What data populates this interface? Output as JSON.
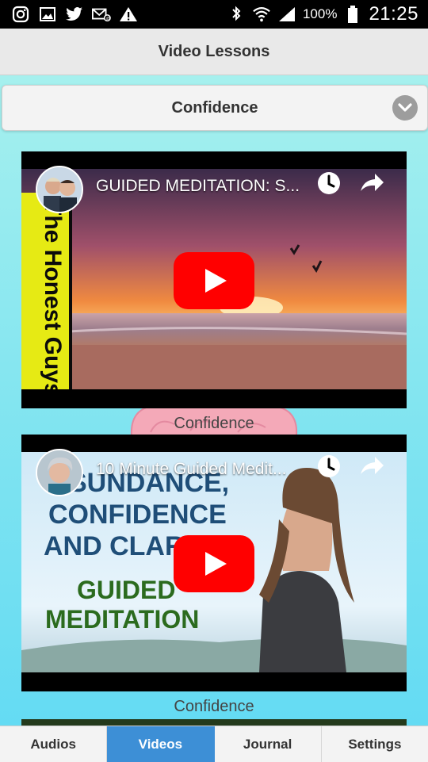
{
  "status_bar": {
    "battery": "100%",
    "time": "21:25",
    "left_icons": [
      "instagram-icon",
      "image-icon",
      "twitter-icon",
      "mail-icon",
      "warning-icon"
    ],
    "right_icons": [
      "bluetooth-icon",
      "wifi-icon",
      "signal-icon",
      "battery-icon"
    ]
  },
  "header": {
    "title": "Video Lessons"
  },
  "category_select": {
    "value": "Confidence"
  },
  "videos": [
    {
      "title": "GUIDED MEDITATION: S...",
      "caption": "Confidence",
      "thumb_text": "The Honest Guys"
    },
    {
      "title": "10 Minute Guided Medit...",
      "caption": "Confidence",
      "thumb_lines": [
        "SUNDANCE,",
        "CONFIDENCE",
        "AND CLARITY",
        "GUIDED",
        "MEDITATION"
      ]
    }
  ],
  "tabs": [
    {
      "label": "Audios",
      "active": false
    },
    {
      "label": "Videos",
      "active": true
    },
    {
      "label": "Journal",
      "active": false
    },
    {
      "label": "Settings",
      "active": false
    }
  ],
  "colors": {
    "accent": "#3d8fd6",
    "play_red": "#ff0000"
  }
}
